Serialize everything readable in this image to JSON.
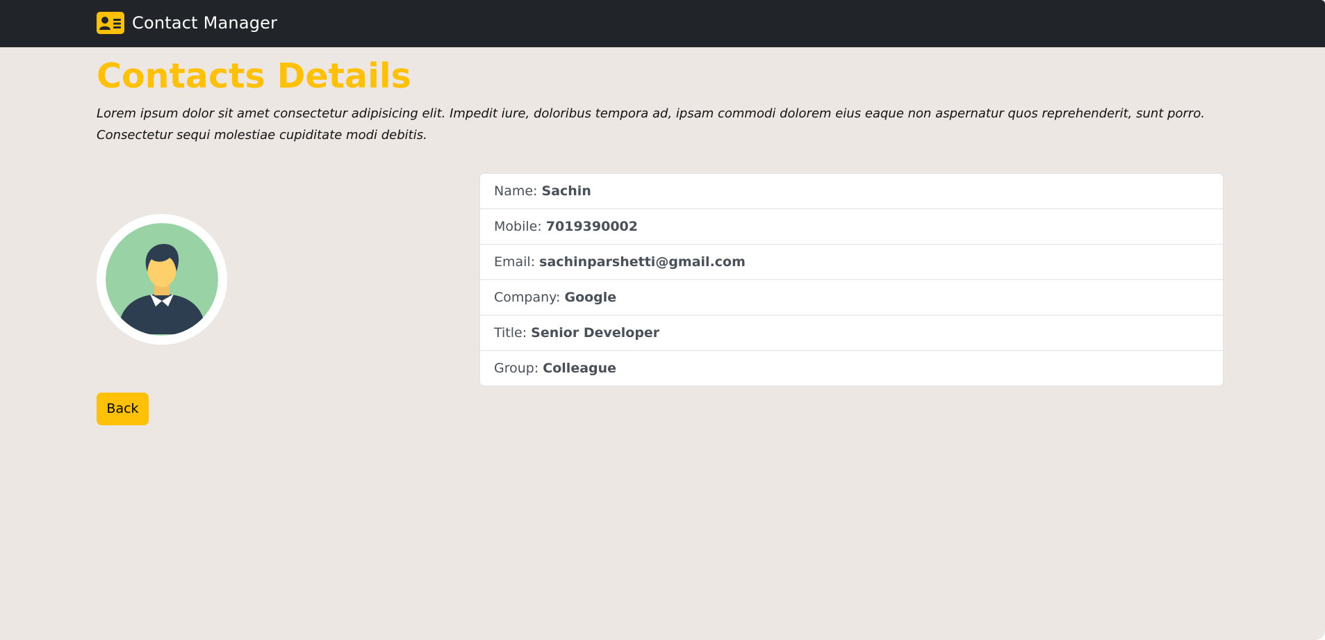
{
  "navbar": {
    "brand_label": "Contact Manager",
    "brand_icon": "address-card-icon",
    "background_color": "#212529",
    "accent_color": "#ffc107"
  },
  "page": {
    "title": "Contacts Details",
    "description": "Lorem ipsum dolor sit amet consectetur adipisicing elit. Impedit iure, doloribus tempora ad, ipsam commodi dolorem eius eaque non aspernatur quos reprehenderit, sunt porro. Consectetur sequi molestiae cupiditate modi debitis.",
    "background_color": "#ece7e3"
  },
  "contact": {
    "avatar_icon": "user-avatar-icon",
    "details": [
      {
        "label": "Name:",
        "value": "Sachin"
      },
      {
        "label": "Mobile:",
        "value": "7019390002"
      },
      {
        "label": "Email:",
        "value": "sachinparshetti@gmail.com"
      },
      {
        "label": "Company:",
        "value": "Google"
      },
      {
        "label": "Title:",
        "value": "Senior Developer"
      },
      {
        "label": "Group:",
        "value": "Colleague"
      }
    ]
  },
  "actions": {
    "back_label": "Back"
  }
}
